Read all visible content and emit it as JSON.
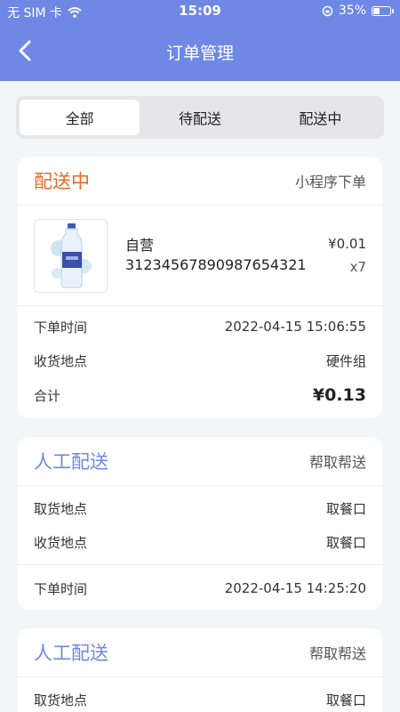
{
  "status_bar": {
    "carrier": "无 SIM 卡",
    "time": "15:09",
    "battery": "35%"
  },
  "nav": {
    "title": "订单管理"
  },
  "tabs": [
    {
      "label": "全部",
      "active": true
    },
    {
      "label": "待配送",
      "active": false
    },
    {
      "label": "配送中",
      "active": false
    }
  ],
  "colors": {
    "header": "#6f88e6",
    "status_orange": "#e8692b",
    "status_blue": "#6f88e6"
  },
  "orders": [
    {
      "status": "配送中",
      "source": "小程序下单",
      "product": {
        "name": "自营",
        "code": "31234567890987654321",
        "price": "¥0.01",
        "qty": "x7",
        "icon": "water-bottle-icon"
      },
      "order_time_label": "下单时间",
      "order_time": "2022-04-15 15:06:55",
      "delivery_label": "收货地点",
      "delivery": "硬件组",
      "total_label": "合计",
      "total": "¥0.13"
    },
    {
      "status": "人工配送",
      "source": "帮取帮送",
      "pickup_label": "取货地点",
      "pickup": "取餐口",
      "delivery_label": "收货地点",
      "delivery": "取餐口",
      "order_time_label": "下单时间",
      "order_time": "2022-04-15 14:25:20"
    },
    {
      "status": "人工配送",
      "source": "帮取帮送",
      "pickup_label": "取货地点",
      "pickup": "取餐口"
    }
  ]
}
